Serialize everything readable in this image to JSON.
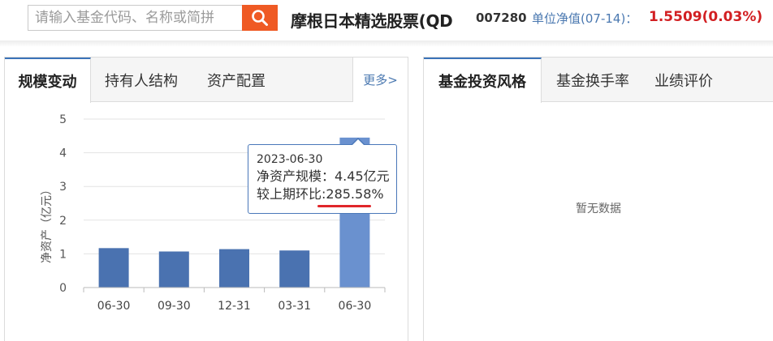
{
  "search": {
    "placeholder": "请输入基金代码、名称或简拼"
  },
  "fund": {
    "name": "摩根日本精选股票(QD",
    "code": "007280",
    "nav_label": "单位净值(07-14)：",
    "nav_value": "1.5509(0.03%)"
  },
  "left_panel": {
    "tabs": [
      {
        "label": "规模变动",
        "active": true
      },
      {
        "label": "持有人结构",
        "active": false
      },
      {
        "label": "资产配置",
        "active": false
      }
    ],
    "more_label": "更多>"
  },
  "right_panel": {
    "tabs": [
      {
        "label": "基金投资风格",
        "active": true
      },
      {
        "label": "基金换手率",
        "active": false
      },
      {
        "label": "业绩评价",
        "active": false
      }
    ],
    "empty_text": "暂无数据"
  },
  "tooltip": {
    "date": "2023-06-30",
    "line1": "净资产规模：4.45亿元",
    "line2": "较上期环比:285.58%"
  },
  "colors": {
    "accent": "#3b73b9",
    "bar": "#4a72b0",
    "bar_highlight": "#6a91cf",
    "search_button": "#ef5a24",
    "price": "#d21f22",
    "link": "#4a78b0"
  },
  "chart_data": {
    "type": "bar",
    "ylabel": "净资产（亿元）",
    "categories": [
      "06-30",
      "09-30",
      "12-31",
      "03-31",
      "06-30"
    ],
    "values": [
      1.17,
      1.07,
      1.14,
      1.1,
      4.45
    ],
    "ylim": [
      0,
      5
    ],
    "yticks": [
      0,
      1,
      2,
      3,
      4,
      5
    ],
    "highlight_index": 4,
    "grid": true
  }
}
